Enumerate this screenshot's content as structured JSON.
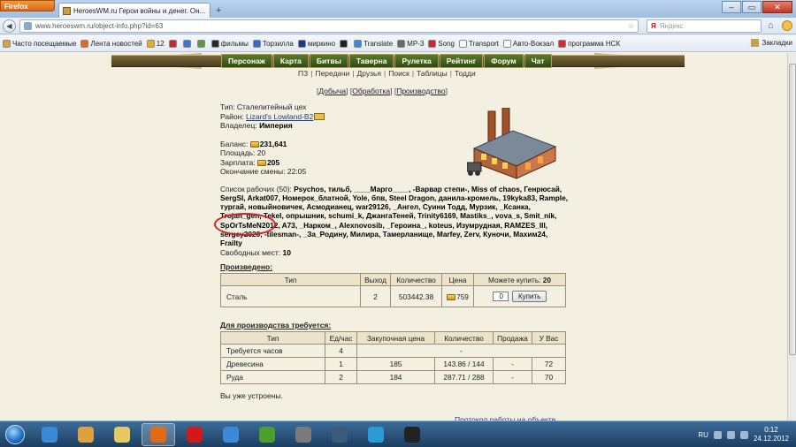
{
  "browser": {
    "menu_button": "Firefox",
    "tab_title": "HeroesWM.ru Герои войны и денег. Он...",
    "url": "www.heroeswm.ru/object-info.php?id=63",
    "search_placeholder": "Яндекс",
    "search_logo": "Я",
    "bookmarks": [
      {
        "label": "Часто посещаемые",
        "color": "#d9a23a"
      },
      {
        "label": "Лента новостей",
        "color": "#e36a1a"
      },
      {
        "label": "12",
        "color": "#e3b21a"
      },
      {
        "label": "",
        "color": "#c62a2a"
      },
      {
        "label": "",
        "color": "#3a77c9"
      },
      {
        "label": "",
        "color": "#5a9a3a"
      },
      {
        "label": "фильмы",
        "color": "#2a2a2a"
      },
      {
        "label": "Торзилла",
        "color": "#3a6ac9"
      },
      {
        "label": "миркино",
        "color": "#1a3a8a"
      },
      {
        "label": "",
        "color": "#222222"
      },
      {
        "label": "Translate",
        "color": "#3a8ad9"
      },
      {
        "label": "MP-3",
        "color": "#6a6a6a"
      },
      {
        "label": "Song",
        "color": "#c62a2a"
      },
      {
        "label": "Transport",
        "color": "#ffffff"
      },
      {
        "label": "Авто-Вокзал",
        "color": "#ffffff"
      },
      {
        "label": "программа НСК",
        "color": "#d92a2a"
      }
    ],
    "bookmarks_right": "Закладки"
  },
  "game_menu": {
    "items": [
      "Персонаж",
      "Карта",
      "Битвы",
      "Таверна",
      "Рулетка",
      "Рейтинг",
      "Форум",
      "Чат"
    ],
    "submenu": [
      "ПЗ",
      "Передачи",
      "Друзья",
      "Поиск",
      "Таблицы",
      "Тодди"
    ]
  },
  "object_tabs": [
    "Добыча",
    "Обработка",
    "Производство"
  ],
  "object": {
    "type_label": "Тип:",
    "type_value": "Сталелитейный цех",
    "region_label": "Район:",
    "region_value": "Lizard's Lowland-B2",
    "owner_label": "Владелец:",
    "owner_value": "Империя",
    "balance_label": "Баланс:",
    "balance_value": "231,641",
    "area_label": "Площадь:",
    "area_value": "20",
    "salary_label": "Зарплата:",
    "salary_value": "205",
    "shift_end_label": "Окончание смены:",
    "shift_end_value": "22:05",
    "workers_label": "Список рабочих (50):",
    "workers": "Psychos, тильб, ____Марго____, -Варвар степи-, Miss of chaos, Генрюсай, SergSI, Arkat007, Номерок_блатной, Yole, бпв, Steel Dragon, данила-кромель, 19kyka83, Rample, тургай, новыйновичек, Асмодианец, war29126, _Ангел, Суини Тодд, Мурзик, _Ксанка, Trojan_gen, Tekel, опрышник, schumi_k, ДжангаТеней, Trinity6169, Mastiks_, vova_s, Smit_nik, SpOrTsMeN2012, A73, _Нарком_, Alexnovosib, _Героина_, koteus, Изумрудная, RAMZES_III, sergey2020, -tilesman-, _За_Родину, Милира, Тамерланище, Marfey, Zerv, Куночи, Maxим24, Frailty",
    "free_places_label": "Свободных мест:",
    "free_places_value": "10"
  },
  "produced": {
    "caption": "Произведено:",
    "headers": [
      "Тип",
      "Выход",
      "Количество",
      "Цена",
      "Можете купить:"
    ],
    "can_buy_value": "20",
    "row": {
      "type": "Сталь",
      "output": "2",
      "quantity": "503442.38",
      "price": "759"
    },
    "quantity_input": "0",
    "buy_label": "Купить"
  },
  "required": {
    "caption": "Для производства требуется:",
    "headers": [
      "Тип",
      "Ед/час",
      "Закупочная цена",
      "Количество",
      "Продажа",
      "У Вас"
    ],
    "rows": [
      {
        "type": "Требуется часов",
        "per_hour": "4",
        "price": "",
        "quantity": "-",
        "sale": "",
        "have": ""
      },
      {
        "type": "Древесина",
        "per_hour": "1",
        "price": "185",
        "quantity": "143.86 / 144",
        "sale": "-",
        "have": "72"
      },
      {
        "type": "Руда",
        "per_hour": "2",
        "price": "184",
        "quantity": "287.71 / 288",
        "sale": "-",
        "have": "70"
      }
    ]
  },
  "status_text": "Вы уже устроены.",
  "protocol_link": "Протокол работы на объекте",
  "taskbar": {
    "apps": [
      {
        "name": "internet-explorer",
        "color": "#3a8ad9"
      },
      {
        "name": "media-app",
        "color": "#e0a040"
      },
      {
        "name": "file-explorer",
        "color": "#e8c860"
      },
      {
        "name": "firefox",
        "color": "#e06a1a"
      },
      {
        "name": "opera",
        "color": "#d01a1a"
      },
      {
        "name": "mail-agent",
        "color": "#3a8ad9"
      },
      {
        "name": "utorrent",
        "color": "#4aa02a"
      },
      {
        "name": "game-app",
        "color": "#7a7a7a"
      },
      {
        "name": "monitor-app",
        "color": "#3a5a7a"
      },
      {
        "name": "skype",
        "color": "#2a9ad9"
      },
      {
        "name": "heroes-app",
        "color": "#222222"
      }
    ],
    "language": "RU",
    "time": "0:12",
    "date": "24.12.2012"
  }
}
